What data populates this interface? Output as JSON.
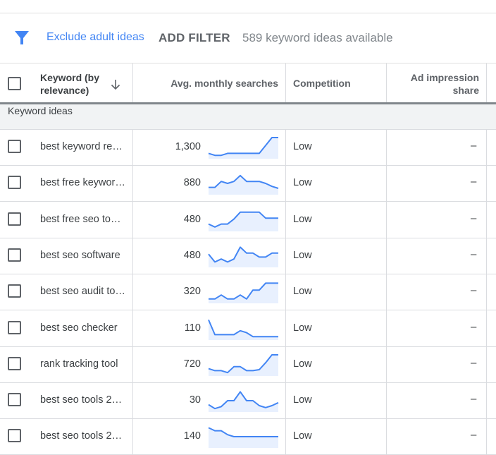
{
  "toolbar": {
    "filter_icon": "filter-funnel-icon",
    "exclude_label": "Exclude adult ideas",
    "add_filter_label": "ADD FILTER",
    "available_text": "589 keyword ideas available"
  },
  "colors": {
    "accent": "#4285f4",
    "sparkline": "#4285f4",
    "sparkline_fill": "#e8f0fe",
    "group_bg": "#f1f3f4"
  },
  "table": {
    "columns": [
      {
        "label": "Keyword (by relevance)",
        "sort": "descending"
      },
      {
        "label": "Avg. monthly searches"
      },
      {
        "label": "Competition"
      },
      {
        "label": "Ad impression share"
      }
    ],
    "col_keyword_line1": "Keyword (by",
    "col_keyword_line2": "relevance)",
    "col_searches": "Avg. monthly searches",
    "col_competition": "Competition",
    "col_impression_line1": "Ad impression",
    "col_impression_line2": "share",
    "group_label": "Keyword ideas",
    "rows": [
      {
        "keyword": "best keyword re…",
        "searches": "1,300",
        "competition": "Low",
        "impression_share": "–",
        "trend": [
          0.2,
          0.1,
          0.1,
          0.2,
          0.2,
          0.2,
          0.2,
          0.2,
          0.2,
          0.6,
          1.0,
          1.0
        ]
      },
      {
        "keyword": "best free keywor…",
        "searches": "880",
        "competition": "Low",
        "impression_share": "–",
        "trend": [
          0.3,
          0.3,
          0.6,
          0.5,
          0.6,
          0.9,
          0.6,
          0.6,
          0.6,
          0.5,
          0.35,
          0.25
        ]
      },
      {
        "keyword": "best free seo to…",
        "searches": "480",
        "competition": "Low",
        "impression_share": "–",
        "trend": [
          0.3,
          0.15,
          0.3,
          0.3,
          0.55,
          0.9,
          0.9,
          0.9,
          0.9,
          0.6,
          0.6,
          0.6
        ]
      },
      {
        "keyword": "best seo software",
        "searches": "480",
        "competition": "Low",
        "impression_share": "–",
        "trend": [
          0.6,
          0.2,
          0.35,
          0.2,
          0.35,
          0.95,
          0.65,
          0.65,
          0.45,
          0.45,
          0.65,
          0.65
        ]
      },
      {
        "keyword": "best seo audit to…",
        "searches": "320",
        "competition": "Low",
        "impression_share": "–",
        "trend": [
          0.15,
          0.15,
          0.35,
          0.15,
          0.15,
          0.35,
          0.15,
          0.6,
          0.6,
          0.95,
          0.95,
          0.95
        ]
      },
      {
        "keyword": "best seo checker",
        "searches": "110",
        "competition": "Low",
        "impression_share": "–",
        "trend": [
          0.95,
          0.2,
          0.2,
          0.2,
          0.2,
          0.4,
          0.3,
          0.1,
          0.1,
          0.1,
          0.1,
          0.1
        ]
      },
      {
        "keyword": "rank tracking tool",
        "searches": "720",
        "competition": "Low",
        "impression_share": "–",
        "trend": [
          0.3,
          0.2,
          0.2,
          0.1,
          0.4,
          0.4,
          0.2,
          0.2,
          0.25,
          0.6,
          1.0,
          1.0
        ]
      },
      {
        "keyword": "best seo tools 2…",
        "searches": "30",
        "competition": "Low",
        "impression_share": "–",
        "trend": [
          0.3,
          0.1,
          0.2,
          0.5,
          0.5,
          0.95,
          0.5,
          0.5,
          0.25,
          0.15,
          0.25,
          0.4
        ]
      },
      {
        "keyword": "best seo tools 2…",
        "searches": "140",
        "competition": "Low",
        "impression_share": "–",
        "trend": [
          0.95,
          0.8,
          0.8,
          0.6,
          0.5,
          0.5,
          0.5,
          0.5,
          0.5,
          0.5,
          0.5,
          0.5
        ]
      }
    ]
  }
}
